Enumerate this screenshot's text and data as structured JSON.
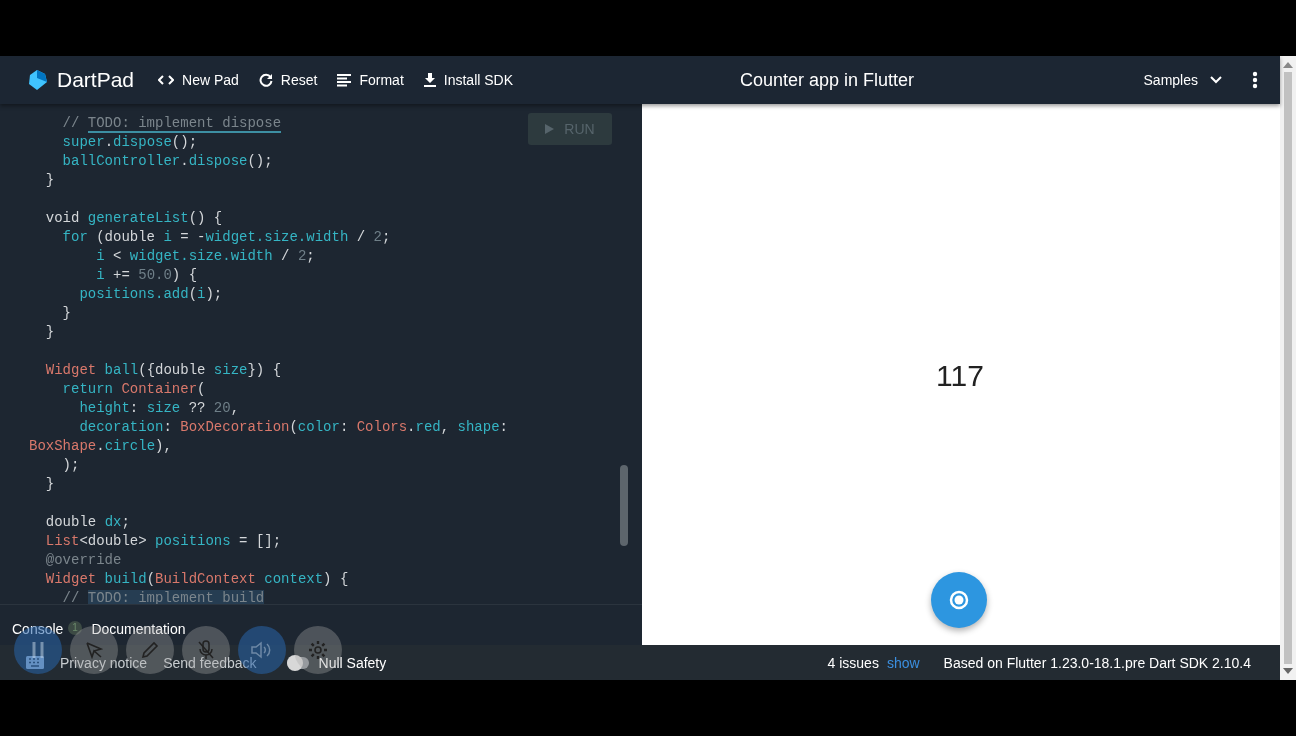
{
  "header": {
    "logo": "DartPad",
    "actions": [
      {
        "kind": "code",
        "label": "New Pad"
      },
      {
        "kind": "reset",
        "label": "Reset"
      },
      {
        "kind": "format",
        "label": "Format"
      },
      {
        "kind": "download",
        "label": "Install SDK"
      }
    ],
    "title": "Counter app in Flutter",
    "samples": "Samples"
  },
  "editor": {
    "run": {
      "label": "RUN",
      "disabled": true
    },
    "lines": [
      {
        "tokens": [
          {
            "kind": "comment",
            "text": "    // "
          },
          {
            "kind": "todo",
            "text": "TODO: implement dispose"
          }
        ]
      },
      {
        "tokens": [
          {
            "kind": "ident",
            "text": "    super"
          },
          {
            "kind": "plain",
            "text": "."
          },
          {
            "kind": "ident",
            "text": "dispose"
          },
          {
            "kind": "plain",
            "text": "();"
          }
        ]
      },
      {
        "tokens": [
          {
            "kind": "ident",
            "text": "    ballController"
          },
          {
            "kind": "plain",
            "text": "."
          },
          {
            "kind": "ident",
            "text": "dispose"
          },
          {
            "kind": "plain",
            "text": "();"
          }
        ]
      },
      {
        "tokens": [
          {
            "kind": "plain",
            "text": "  }"
          }
        ]
      },
      {
        "gap_before": true,
        "tokens": [
          {
            "kind": "plain",
            "text": "  void "
          },
          {
            "kind": "ident",
            "text": "generateList"
          },
          {
            "kind": "plain",
            "text": "() {"
          }
        ]
      },
      {
        "tokens": [
          {
            "kind": "ident",
            "text": "    for"
          },
          {
            "kind": "plain",
            "text": " (double "
          },
          {
            "kind": "ident",
            "text": "i"
          },
          {
            "kind": "plain",
            "text": " = -"
          },
          {
            "kind": "ident",
            "text": "widget.size.width"
          },
          {
            "kind": "plain",
            "text": " / "
          },
          {
            "kind": "number",
            "text": "2"
          },
          {
            "kind": "plain",
            "text": ";"
          }
        ]
      },
      {
        "tokens": [
          {
            "kind": "ident",
            "text": "        i"
          },
          {
            "kind": "plain",
            "text": " < "
          },
          {
            "kind": "ident",
            "text": "widget.size.width"
          },
          {
            "kind": "plain",
            "text": " / "
          },
          {
            "kind": "number",
            "text": "2"
          },
          {
            "kind": "plain",
            "text": ";"
          }
        ]
      },
      {
        "tokens": [
          {
            "kind": "ident",
            "text": "        i"
          },
          {
            "kind": "plain",
            "text": " += "
          },
          {
            "kind": "number",
            "text": "50.0"
          },
          {
            "kind": "plain",
            "text": ") {"
          }
        ]
      },
      {
        "tokens": [
          {
            "kind": "ident",
            "text": "      positions.add"
          },
          {
            "kind": "plain",
            "text": "("
          },
          {
            "kind": "ident",
            "text": "i"
          },
          {
            "kind": "plain",
            "text": ");"
          }
        ]
      },
      {
        "tokens": [
          {
            "kind": "plain",
            "text": "    }"
          }
        ]
      },
      {
        "tokens": [
          {
            "kind": "plain",
            "text": "  }"
          }
        ]
      },
      {
        "gap_before": true,
        "tokens": [
          {
            "kind": "type",
            "text": "  Widget"
          },
          {
            "kind": "ident",
            "text": " ball"
          },
          {
            "kind": "plain",
            "text": "({double "
          },
          {
            "kind": "ident",
            "text": "size"
          },
          {
            "kind": "plain",
            "text": "}) {"
          }
        ]
      },
      {
        "tokens": [
          {
            "kind": "ident",
            "text": "    return"
          },
          {
            "kind": "type",
            "text": " Container"
          },
          {
            "kind": "plain",
            "text": "("
          }
        ]
      },
      {
        "tokens": [
          {
            "kind": "ident",
            "text": "      height"
          },
          {
            "kind": "plain",
            "text": ": "
          },
          {
            "kind": "ident",
            "text": "size"
          },
          {
            "kind": "plain",
            "text": " ?? "
          },
          {
            "kind": "number",
            "text": "20"
          },
          {
            "kind": "plain",
            "text": ","
          }
        ]
      },
      {
        "tokens": [
          {
            "kind": "ident",
            "text": "      decoration"
          },
          {
            "kind": "plain",
            "text": ": "
          },
          {
            "kind": "type",
            "text": "BoxDecoration"
          },
          {
            "kind": "plain",
            "text": "("
          },
          {
            "kind": "ident",
            "text": "color"
          },
          {
            "kind": "plain",
            "text": ": "
          },
          {
            "kind": "type",
            "text": "Colors"
          },
          {
            "kind": "plain",
            "text": "."
          },
          {
            "kind": "ident",
            "text": "red"
          },
          {
            "kind": "plain",
            "text": ", "
          },
          {
            "kind": "ident",
            "text": "shape"
          },
          {
            "kind": "plain",
            "text": ":"
          }
        ]
      },
      {
        "tokens": [
          {
            "kind": "type",
            "text": "BoxShape"
          },
          {
            "kind": "plain",
            "text": "."
          },
          {
            "kind": "ident",
            "text": "circle"
          },
          {
            "kind": "plain",
            "text": "),"
          }
        ]
      },
      {
        "tokens": [
          {
            "kind": "plain",
            "text": "    );"
          }
        ]
      },
      {
        "tokens": [
          {
            "kind": "plain",
            "text": "  }"
          }
        ]
      },
      {
        "gap_before": true,
        "tokens": [
          {
            "kind": "plain",
            "text": "  double "
          },
          {
            "kind": "ident",
            "text": "dx"
          },
          {
            "kind": "plain",
            "text": ";"
          }
        ]
      },
      {
        "tokens": [
          {
            "kind": "type",
            "text": "  List"
          },
          {
            "kind": "plain",
            "text": "<double> "
          },
          {
            "kind": "ident",
            "text": "positions"
          },
          {
            "kind": "plain",
            "text": " = [];"
          }
        ]
      },
      {
        "tokens": [
          {
            "kind": "comment",
            "text": "  @override"
          }
        ]
      },
      {
        "tokens": [
          {
            "kind": "type",
            "text": "  Widget"
          },
          {
            "kind": "ident",
            "text": " build"
          },
          {
            "kind": "plain",
            "text": "("
          },
          {
            "kind": "type",
            "text": "BuildContext"
          },
          {
            "kind": "ident",
            "text": " context"
          },
          {
            "kind": "plain",
            "text": ") {"
          }
        ]
      },
      {
        "tokens": [
          {
            "kind": "comment",
            "text": "    // "
          },
          {
            "kind": "highlight",
            "text": "TODO: implement build"
          }
        ]
      }
    ]
  },
  "console_tabs": [
    {
      "label": "Console",
      "badge": "1"
    },
    {
      "label": "Documentation"
    }
  ],
  "preview": {
    "counter": "117"
  },
  "footer": {
    "privacy": "Privacy notice",
    "feedback": "Send feedback",
    "null_safety": {
      "label": "Null Safety",
      "on": false
    },
    "issues": "4 issues",
    "show": "show",
    "version": "Based on Flutter 1.23.0-18.1.pre Dart SDK 2.10.4"
  },
  "recorder_toolbar": [
    {
      "kind": "pause",
      "selected": true
    },
    {
      "kind": "cursor",
      "selected": false
    },
    {
      "kind": "pen",
      "selected": false
    },
    {
      "kind": "mic-off",
      "selected": false
    },
    {
      "kind": "speaker",
      "selected": true
    },
    {
      "kind": "gear",
      "selected": false
    }
  ]
}
